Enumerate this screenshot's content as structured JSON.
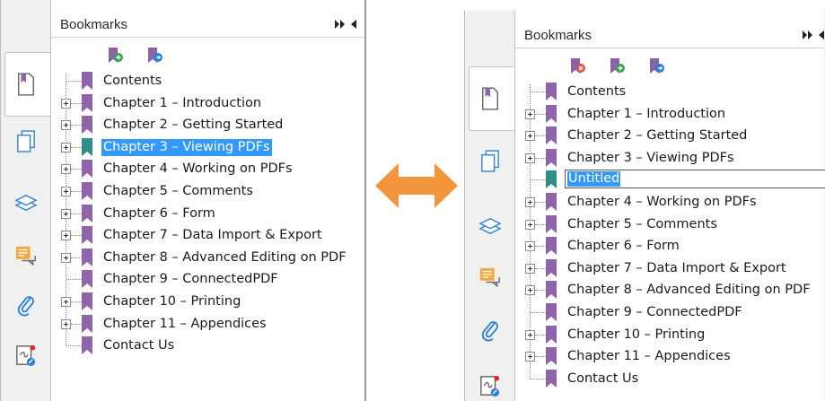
{
  "colors": {
    "bookmark_purple": "#8f64a8",
    "bookmark_teal": "#2f8f86",
    "selection_blue": "#3399ff",
    "arrow_orange": "#f2953c",
    "tool_icon_purple": "#8a62a6",
    "tool_icon_green": "#3aa64c",
    "tool_icon_red": "#d9534f",
    "tool_icon_blue": "#2f7fd1"
  },
  "arrow": {
    "icon": "double-headed-arrow-icon"
  },
  "left_panel": {
    "header": {
      "title": "Bookmarks",
      "collapse_icon": "double-chevron-right-icon",
      "menu_icon": "triangle-left-icon"
    },
    "side_tabs": [
      "bookmarks-page-icon",
      "pages-thumbnail-icon",
      "layers-icon",
      "comments-icon",
      "attachments-icon",
      "signature-icon"
    ],
    "toolbar": [
      "add-bookmark-icon",
      "add-child-bookmark-icon"
    ],
    "bookmarks": [
      {
        "label": "Contents",
        "expandable": false,
        "color": "purple",
        "selected": false
      },
      {
        "label": "Chapter 1 – Introduction",
        "expandable": true,
        "color": "purple",
        "selected": false
      },
      {
        "label": "Chapter 2 – Getting Started",
        "expandable": true,
        "color": "purple",
        "selected": false
      },
      {
        "label": "Chapter 3 – Viewing PDFs",
        "expandable": true,
        "color": "teal",
        "selected": true
      },
      {
        "label": "Chapter 4 – Working on PDFs",
        "expandable": true,
        "color": "purple",
        "selected": false
      },
      {
        "label": "Chapter 5 – Comments",
        "expandable": true,
        "color": "purple",
        "selected": false
      },
      {
        "label": "Chapter 6 – Form",
        "expandable": true,
        "color": "purple",
        "selected": false
      },
      {
        "label": "Chapter 7 – Data Import & Export",
        "expandable": true,
        "color": "purple",
        "selected": false
      },
      {
        "label": "Chapter 8 – Advanced Editing on PDF",
        "expandable": true,
        "color": "purple",
        "selected": false
      },
      {
        "label": "Chapter 9 – ConnectedPDF",
        "expandable": false,
        "color": "purple",
        "selected": false
      },
      {
        "label": "Chapter 10 – Printing",
        "expandable": true,
        "color": "purple",
        "selected": false
      },
      {
        "label": "Chapter 11 – Appendices",
        "expandable": true,
        "color": "purple",
        "selected": false
      },
      {
        "label": "Contact Us",
        "expandable": false,
        "color": "purple",
        "selected": false
      }
    ]
  },
  "right_panel": {
    "header": {
      "title": "Bookmarks",
      "collapse_icon": "double-chevron-right-icon",
      "menu_icon": "triangle-left-icon"
    },
    "side_tabs": [
      "bookmarks-page-icon",
      "pages-thumbnail-icon",
      "layers-icon",
      "comments-icon",
      "attachments-icon",
      "signature-icon"
    ],
    "toolbar": [
      "delete-bookmark-icon",
      "add-bookmark-icon",
      "add-child-bookmark-icon"
    ],
    "bookmarks": [
      {
        "label": "Contents",
        "expandable": false,
        "color": "purple",
        "editing": false
      },
      {
        "label": "Chapter 1 – Introduction",
        "expandable": true,
        "color": "purple",
        "editing": false
      },
      {
        "label": "Chapter 2 – Getting Started",
        "expandable": true,
        "color": "purple",
        "editing": false
      },
      {
        "label": "Chapter 3 – Viewing PDFs",
        "expandable": true,
        "color": "purple",
        "editing": false
      },
      {
        "label": "Untitled",
        "expandable": false,
        "color": "teal",
        "editing": true
      },
      {
        "label": "Chapter 4 – Working on PDFs",
        "expandable": true,
        "color": "purple",
        "editing": false
      },
      {
        "label": "Chapter 5 – Comments",
        "expandable": true,
        "color": "purple",
        "editing": false
      },
      {
        "label": "Chapter 6 – Form",
        "expandable": true,
        "color": "purple",
        "editing": false
      },
      {
        "label": "Chapter 7 – Data Import & Export",
        "expandable": true,
        "color": "purple",
        "editing": false
      },
      {
        "label": "Chapter 8 – Advanced Editing on PDF",
        "expandable": true,
        "color": "purple",
        "editing": false
      },
      {
        "label": "Chapter 9 – ConnectedPDF",
        "expandable": false,
        "color": "purple",
        "editing": false
      },
      {
        "label": "Chapter 10 – Printing",
        "expandable": true,
        "color": "purple",
        "editing": false
      },
      {
        "label": "Chapter 11 – Appendices",
        "expandable": true,
        "color": "purple",
        "editing": false
      },
      {
        "label": "Contact Us",
        "expandable": false,
        "color": "purple",
        "editing": false
      }
    ]
  }
}
